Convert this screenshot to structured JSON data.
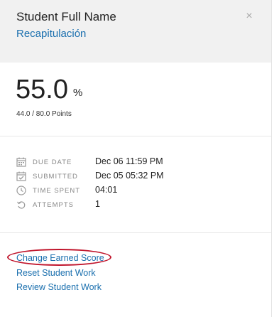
{
  "header": {
    "student_name": "Student Full Name",
    "assignment_title": "Recapitulación",
    "close_symbol": "×"
  },
  "score": {
    "value": "55.0",
    "percent_symbol": "%",
    "points": "44.0 / 80.0 Points"
  },
  "details": [
    {
      "icon": "calendar-icon",
      "label": "DUE DATE",
      "value": "Dec 06 11:59 PM"
    },
    {
      "icon": "checked-calendar-icon",
      "label": "SUBMITTED",
      "value": "Dec 05 05:32 PM"
    },
    {
      "icon": "clock-icon",
      "label": "TIME SPENT",
      "value": "04:01"
    },
    {
      "icon": "undo-icon",
      "label": "ATTEMPTS",
      "value": "1"
    }
  ],
  "actions": {
    "change_score": "Change Earned Score",
    "reset_work": "Reset Student Work",
    "review_work": "Review Student Work"
  },
  "colors": {
    "link": "#1a6fae",
    "highlight": "#c0142b",
    "header_bg": "#f1f1f1"
  }
}
